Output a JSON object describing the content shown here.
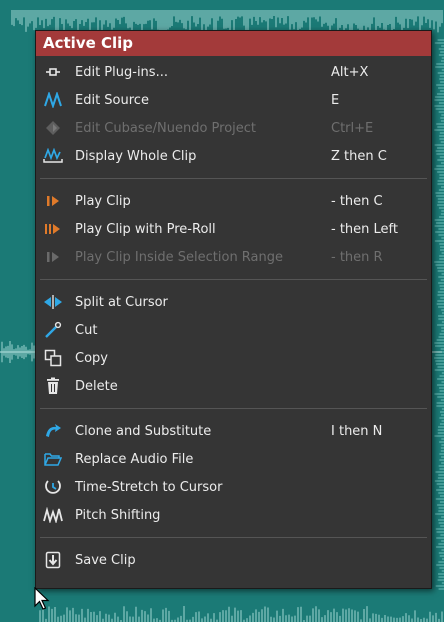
{
  "menu": {
    "title": "Active Clip",
    "groups": [
      [
        {
          "label": "Edit Plug-ins...",
          "shortcut": "Alt+X",
          "icon": "plugin-icon",
          "enabled": true
        },
        {
          "label": "Edit Source",
          "shortcut": "E",
          "icon": "waveform-edit-icon",
          "enabled": true
        },
        {
          "label": "Edit Cubase/Nuendo Project",
          "shortcut": "Ctrl+E",
          "icon": "cubase-icon",
          "enabled": false
        },
        {
          "label": "Display Whole Clip",
          "shortcut": "Z then C",
          "icon": "display-clip-icon",
          "enabled": true
        }
      ],
      [
        {
          "label": "Play Clip",
          "shortcut": "- then C",
          "icon": "play-clip-icon",
          "enabled": true
        },
        {
          "label": "Play Clip with Pre-Roll",
          "shortcut": "- then Left",
          "icon": "play-preroll-icon",
          "enabled": true
        },
        {
          "label": "Play Clip Inside Selection Range",
          "shortcut": "- then R",
          "icon": "play-selection-icon",
          "enabled": false
        }
      ],
      [
        {
          "label": "Split at Cursor",
          "shortcut": "",
          "icon": "split-icon",
          "enabled": true
        },
        {
          "label": "Cut",
          "shortcut": "",
          "icon": "cut-icon",
          "enabled": true
        },
        {
          "label": "Copy",
          "shortcut": "",
          "icon": "copy-icon",
          "enabled": true
        },
        {
          "label": "Delete",
          "shortcut": "",
          "icon": "trash-icon",
          "enabled": true
        }
      ],
      [
        {
          "label": "Clone and Substitute",
          "shortcut": "I then N",
          "icon": "clone-icon",
          "enabled": true
        },
        {
          "label": "Replace Audio File",
          "shortcut": "",
          "icon": "folder-icon",
          "enabled": true
        },
        {
          "label": "Time-Stretch to Cursor",
          "shortcut": "",
          "icon": "time-stretch-icon",
          "enabled": true
        },
        {
          "label": "Pitch Shifting",
          "shortcut": "",
          "icon": "pitch-shift-icon",
          "enabled": true
        }
      ],
      [
        {
          "label": "Save Clip",
          "shortcut": "",
          "icon": "save-clip-icon",
          "enabled": true
        }
      ]
    ]
  },
  "colors": {
    "background": "#1b7a76",
    "header": "#a33a3a",
    "menu_bg": "#353535",
    "text": "#ececec",
    "disabled_text": "#6f6f6f",
    "icon_blue": "#2fa8e6",
    "icon_orange": "#e07a2a"
  }
}
